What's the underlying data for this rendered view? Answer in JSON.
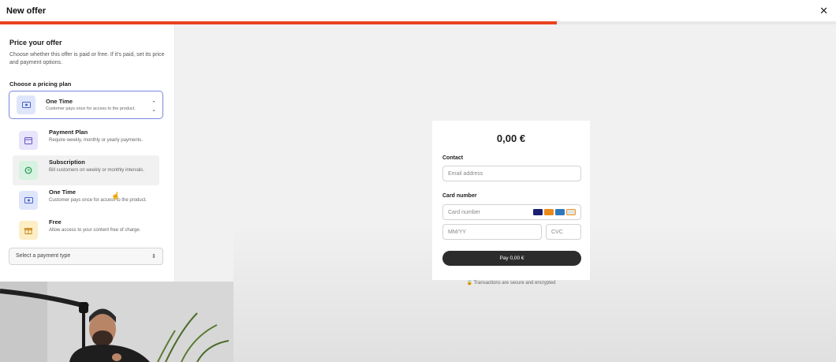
{
  "header": {
    "title": "New offer",
    "close_icon": "close-icon"
  },
  "progress": {
    "percent": 66.6,
    "color": "#e9431f"
  },
  "pricing": {
    "heading": "Price your offer",
    "description": "Choose whether this offer is paid or free. If it's paid, set its price and payment options.",
    "plan_label": "Choose a pricing plan",
    "selected": {
      "title": "One Time",
      "subtitle": "Customer pays once for access to the product.",
      "icon": "cash-icon"
    },
    "options": [
      {
        "title": "Payment Plan",
        "subtitle": "Require weekly, monthly or yearly payments.",
        "icon": "calendar-icon"
      },
      {
        "title": "Subscription",
        "subtitle": "Bill customers on weekly or monthly intervals.",
        "icon": "refresh-icon"
      },
      {
        "title": "One Time",
        "subtitle": "Customer pays once for access to the product.",
        "icon": "cash-icon"
      },
      {
        "title": "Free",
        "subtitle": "Allow access to your content free of charge.",
        "icon": "gift-icon"
      }
    ],
    "payment_type_placeholder": "Select a payment type"
  },
  "checkout": {
    "amount": "0,00 €",
    "contact_label": "Contact",
    "email_placeholder": "Email address",
    "card_label": "Card number",
    "card_placeholder": "Card number",
    "expiry_placeholder": "MM/YY",
    "cvc_placeholder": "CVC",
    "card_brands": [
      "VISA",
      "Mastercard",
      "AMEX",
      "Discover"
    ],
    "pay_button": "Pay 0,00 €",
    "secure_text": "Transactions are secure and encrypted"
  }
}
